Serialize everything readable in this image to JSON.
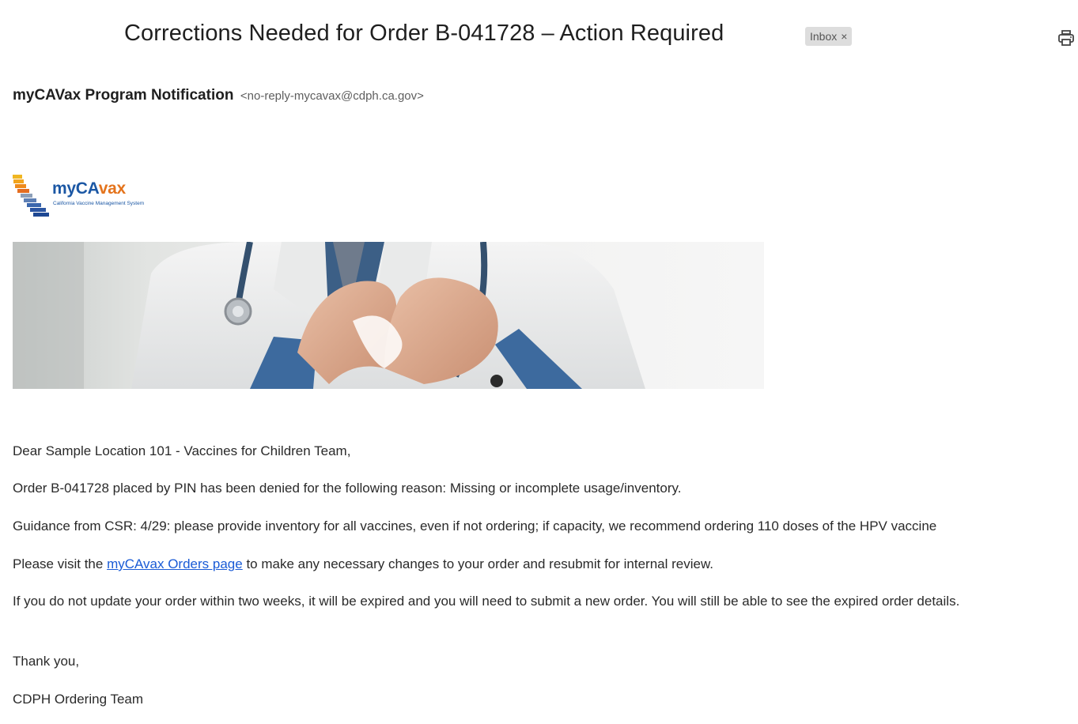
{
  "email": {
    "subject": "Corrections Needed for Order B-041728 – Action Required",
    "label_chip": "Inbox",
    "label_remove": "×",
    "sender_name": "myCAVax Program Notification",
    "sender_email": "<no-reply-mycavax@cdph.ca.gov>"
  },
  "logo": {
    "word_my": "my",
    "word_ca": "CA",
    "word_vax": "vax",
    "tagline": "California Vaccine Management System"
  },
  "body": {
    "greeting": "Dear Sample Location 101 - Vaccines for Children Team,",
    "line1": "Order B-041728 placed by PIN  has been denied for the following reason: Missing or incomplete usage/inventory.",
    "line2": "Guidance from CSR: 4/29: please provide inventory for all vaccines, even if not ordering; if capacity, we recommend ordering 110 doses of the HPV vaccine",
    "line3_before": "Please visit the ",
    "line3_link": "myCAvax Orders page",
    "line3_after": " to make any necessary changes to your order and resubmit for internal review.",
    "line4": "If you do not update your order within two weeks, it will be expired and you will need to submit a new order. You will still be able to see the expired order details.",
    "closing": "Thank you,",
    "signature": "CDPH Ordering Team"
  },
  "colors": {
    "link": "#1a5bd6",
    "logo_blue": "#1b57a4",
    "logo_orange": "#e4741d"
  },
  "icons": {
    "print": "printer-icon"
  }
}
